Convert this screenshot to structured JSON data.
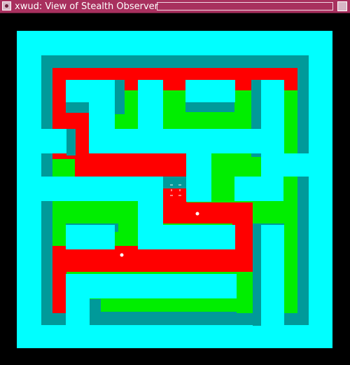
{
  "window": {
    "title": "xwud: View of Stealth Observer"
  },
  "icons": {
    "close": "window-menu-icon",
    "maximize": "maximize-icon"
  },
  "colors": {
    "titlebar": "#a8305e",
    "background": "#000000",
    "wall_top": "#00ffff",
    "wall_side": "#009a9a",
    "floor_green": "#00ee00",
    "trail_red": "#ff0000",
    "marker": "#ffffff"
  }
}
